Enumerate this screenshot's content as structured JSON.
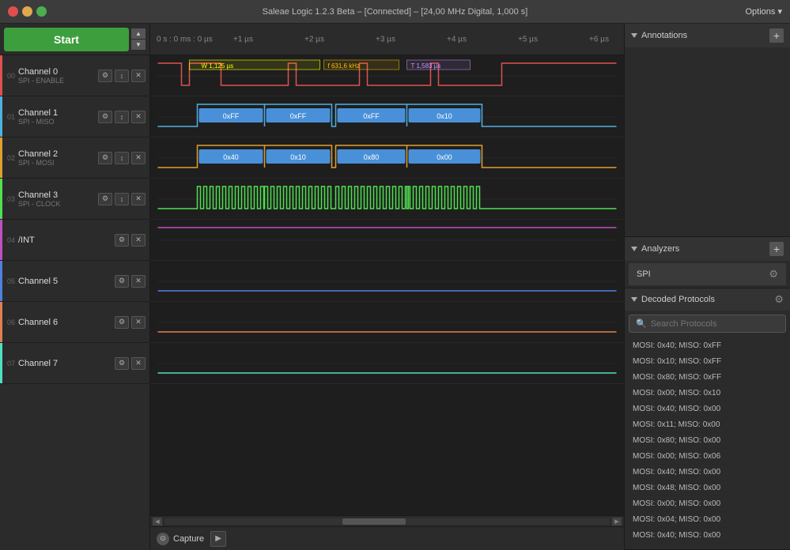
{
  "titlebar": {
    "title": "Saleae Logic 1.2.3 Beta – [Connected] – [24,00 MHz Digital, 1,000 s]",
    "options_label": "Options ▾"
  },
  "start_button": "Start",
  "channels": [
    {
      "num": "00",
      "name": "Channel 0",
      "label": "SPI - ENABLE",
      "color": "#e05050"
    },
    {
      "num": "01",
      "name": "Channel 1",
      "label": "SPI - MISO",
      "color": "#50b0e0"
    },
    {
      "num": "02",
      "name": "Channel 2",
      "label": "SPI - MOSI",
      "color": "#e0a030"
    },
    {
      "num": "03",
      "name": "Channel 3",
      "label": "SPI - CLOCK",
      "color": "#50e050"
    },
    {
      "num": "04",
      "name": "/INT",
      "label": "",
      "color": "#c050c0"
    },
    {
      "num": "05",
      "name": "Channel 5",
      "label": "",
      "color": "#5080e0"
    },
    {
      "num": "06",
      "name": "Channel 6",
      "label": "",
      "color": "#e08050"
    },
    {
      "num": "07",
      "name": "Channel 7",
      "label": "",
      "color": "#50e0c0"
    }
  ],
  "timeline": {
    "zero_label": "0 s : 0 ms : 0 µs",
    "markers": [
      "+1 µs",
      "+2 µs",
      "+3 µs",
      "+4 µs",
      "+5 µs",
      "+6 µs"
    ]
  },
  "measurements": {
    "width_label": "W",
    "freq_label": "f",
    "time_label": "T",
    "width_val": "1,125 µs",
    "freq_val": "631,6 kHz",
    "time_val": "1,583 µs"
  },
  "spi_data": {
    "miso": [
      "0xFF",
      "0xFF",
      "0xFF",
      "0x10"
    ],
    "mosi": [
      "0x40",
      "0x10",
      "0x80",
      "0x00"
    ]
  },
  "right_panel": {
    "annotations_label": "Annotations",
    "analyzers_label": "Analyzers",
    "decoded_label": "Decoded Protocols",
    "search_placeholder": "Search Protocols",
    "add_button": "+",
    "spi_analyzer": "SPI",
    "protocols": [
      "MOSI: 0x40; MISO: 0xFF",
      "MOSI: 0x10; MISO: 0xFF",
      "MOSI: 0x80; MISO: 0xFF",
      "MOSI: 0x00; MISO: 0x10",
      "MOSI: 0x40; MISO: 0x00",
      "MOSI: 0x11; MISO: 0x00",
      "MOSI: 0x80; MISO: 0x00",
      "MOSI: 0x00; MISO: 0x06",
      "MOSI: 0x40; MISO: 0x00",
      "MOSI: 0x48; MISO: 0x00",
      "MOSI: 0x00; MISO: 0x00",
      "MOSI: 0x04; MISO: 0x00",
      "MOSI: 0x40; MISO: 0x00"
    ]
  },
  "bottom": {
    "capture_label": "Capture"
  }
}
